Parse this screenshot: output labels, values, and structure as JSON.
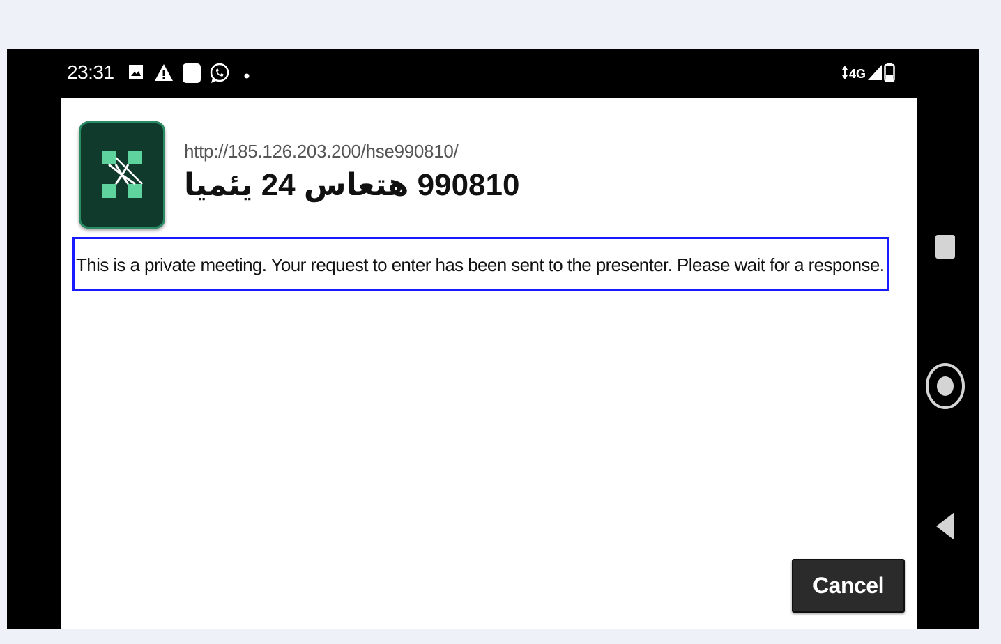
{
  "status_bar": {
    "time": "23:31",
    "left_icons": [
      "gallery-icon",
      "warning-icon",
      "app-square-icon",
      "whatsapp-icon",
      "notification-dot-icon"
    ],
    "network": "4G",
    "right_icons": [
      "data-arrows-icon",
      "signal-icon",
      "battery-icon"
    ]
  },
  "dialog": {
    "app_icon": "adobe-connect-icon",
    "url": "http://185.126.203.200/hse990810/",
    "meeting_title": "990810 هتعاس 24 یئمیا",
    "message": "This is a private meeting. Your request to enter has been sent to the presenter. Please wait for a response.",
    "cancel_label": "Cancel"
  },
  "nav_bar": {
    "buttons": [
      "recents-square-icon",
      "home-circle-icon",
      "back-triangle-icon"
    ]
  },
  "colors": {
    "highlight_border": "#1a1aff",
    "phone_frame": "#000000",
    "page_background": "#eef2f8",
    "button_background": "#2b2b2b"
  }
}
